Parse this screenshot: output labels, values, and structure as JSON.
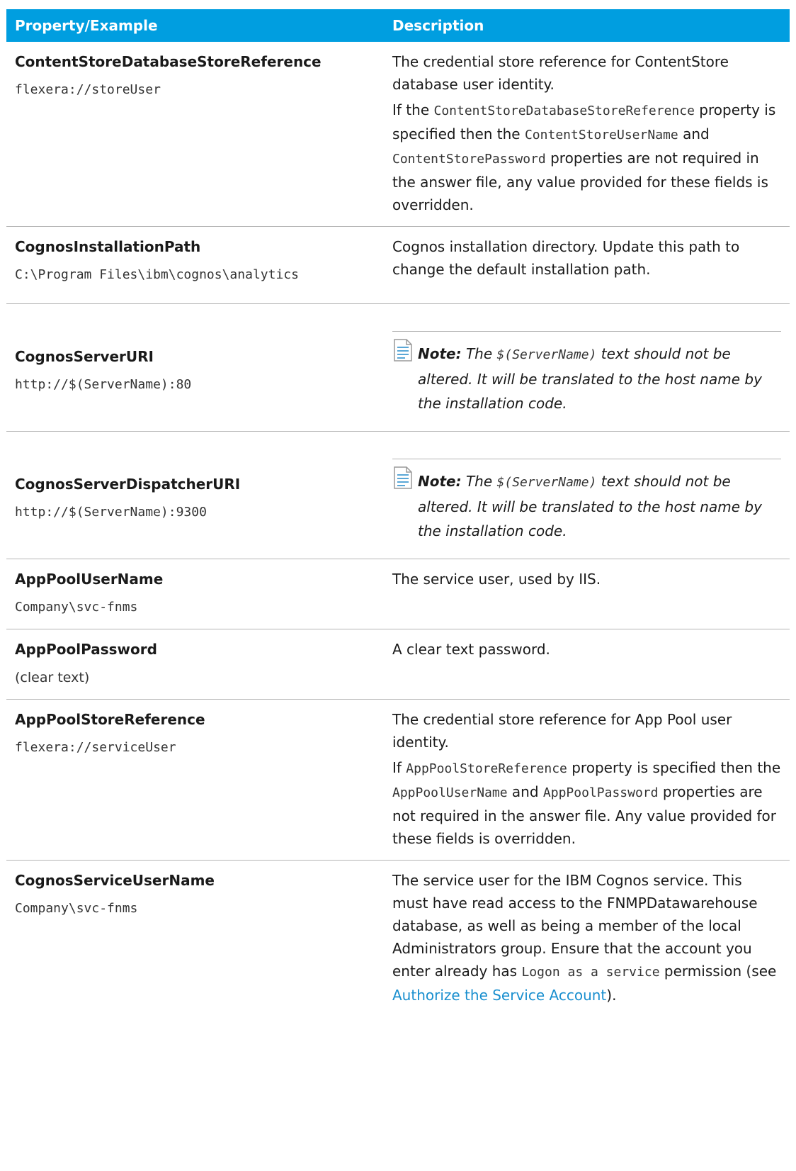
{
  "header": {
    "col1": "Property/Example",
    "col2": "Description"
  },
  "rows": [
    {
      "name": "ContentStoreDatabaseStoreReference",
      "value": "flexera://storeUser",
      "desc1": "The credential store reference for ContentStore database user identity.",
      "desc2_pre": "If the ",
      "desc2_code1": "ContentStoreDatabaseStoreReference",
      "desc2_mid1": " property is specified then the ",
      "desc2_code2": "ContentStoreUserName",
      "desc2_mid2": " and ",
      "desc2_code3": "ContentStorePassword",
      "desc2_post": " properties are not required in the answer file, any value provided for these fields is overridden."
    },
    {
      "name": "CognosInstallationPath",
      "value": "C:\\Program Files\\ibm\\cognos\\analytics",
      "desc": "Cognos installation directory. Update this path to change the default installation path."
    },
    {
      "name": "CognosServerURI",
      "value": "http://$(ServerName):80",
      "note_label": "Note:",
      "note_pre": " The ",
      "note_code": "$(ServerName)",
      "note_post": " text should not be altered. It will be translated to the host name by the installation code."
    },
    {
      "name": "CognosServerDispatcherURI",
      "value": "http://$(ServerName):9300",
      "note_label": "Note:",
      "note_pre": " The ",
      "note_code": "$(ServerName)",
      "note_post": " text should not be altered. It will be translated to the host name by the installation code."
    },
    {
      "name": "AppPoolUserName",
      "value": "Company\\svc-fnms",
      "desc": "The service user, used by IIS."
    },
    {
      "name": "AppPoolPassword",
      "value": "(clear text)",
      "desc": "A clear text password."
    },
    {
      "name": "AppPoolStoreReference",
      "value": "flexera://serviceUser",
      "desc1": "The credential store reference for App Pool user identity.",
      "desc2_pre": "If ",
      "desc2_code1": "AppPoolStoreReference",
      "desc2_mid1": " property is specified then the ",
      "desc2_code2": "AppPoolUserName",
      "desc2_mid2": " and ",
      "desc2_code3": "AppPoolPassword",
      "desc2_post": " properties are not required in the answer file. Any value provided for these fields is overridden."
    },
    {
      "name": "CognosServiceUserName",
      "value": "Company\\svc-fnms",
      "desc_pre": "The service user for the IBM Cognos service. This must have read access to the FNMPDatawarehouse database, as well as being a member of the local Administrators group. Ensure that the account you enter already has ",
      "desc_code": "Logon as a service",
      "desc_mid": " permission (see ",
      "desc_link": "Authorize the Service Account",
      "desc_post": ")."
    }
  ]
}
